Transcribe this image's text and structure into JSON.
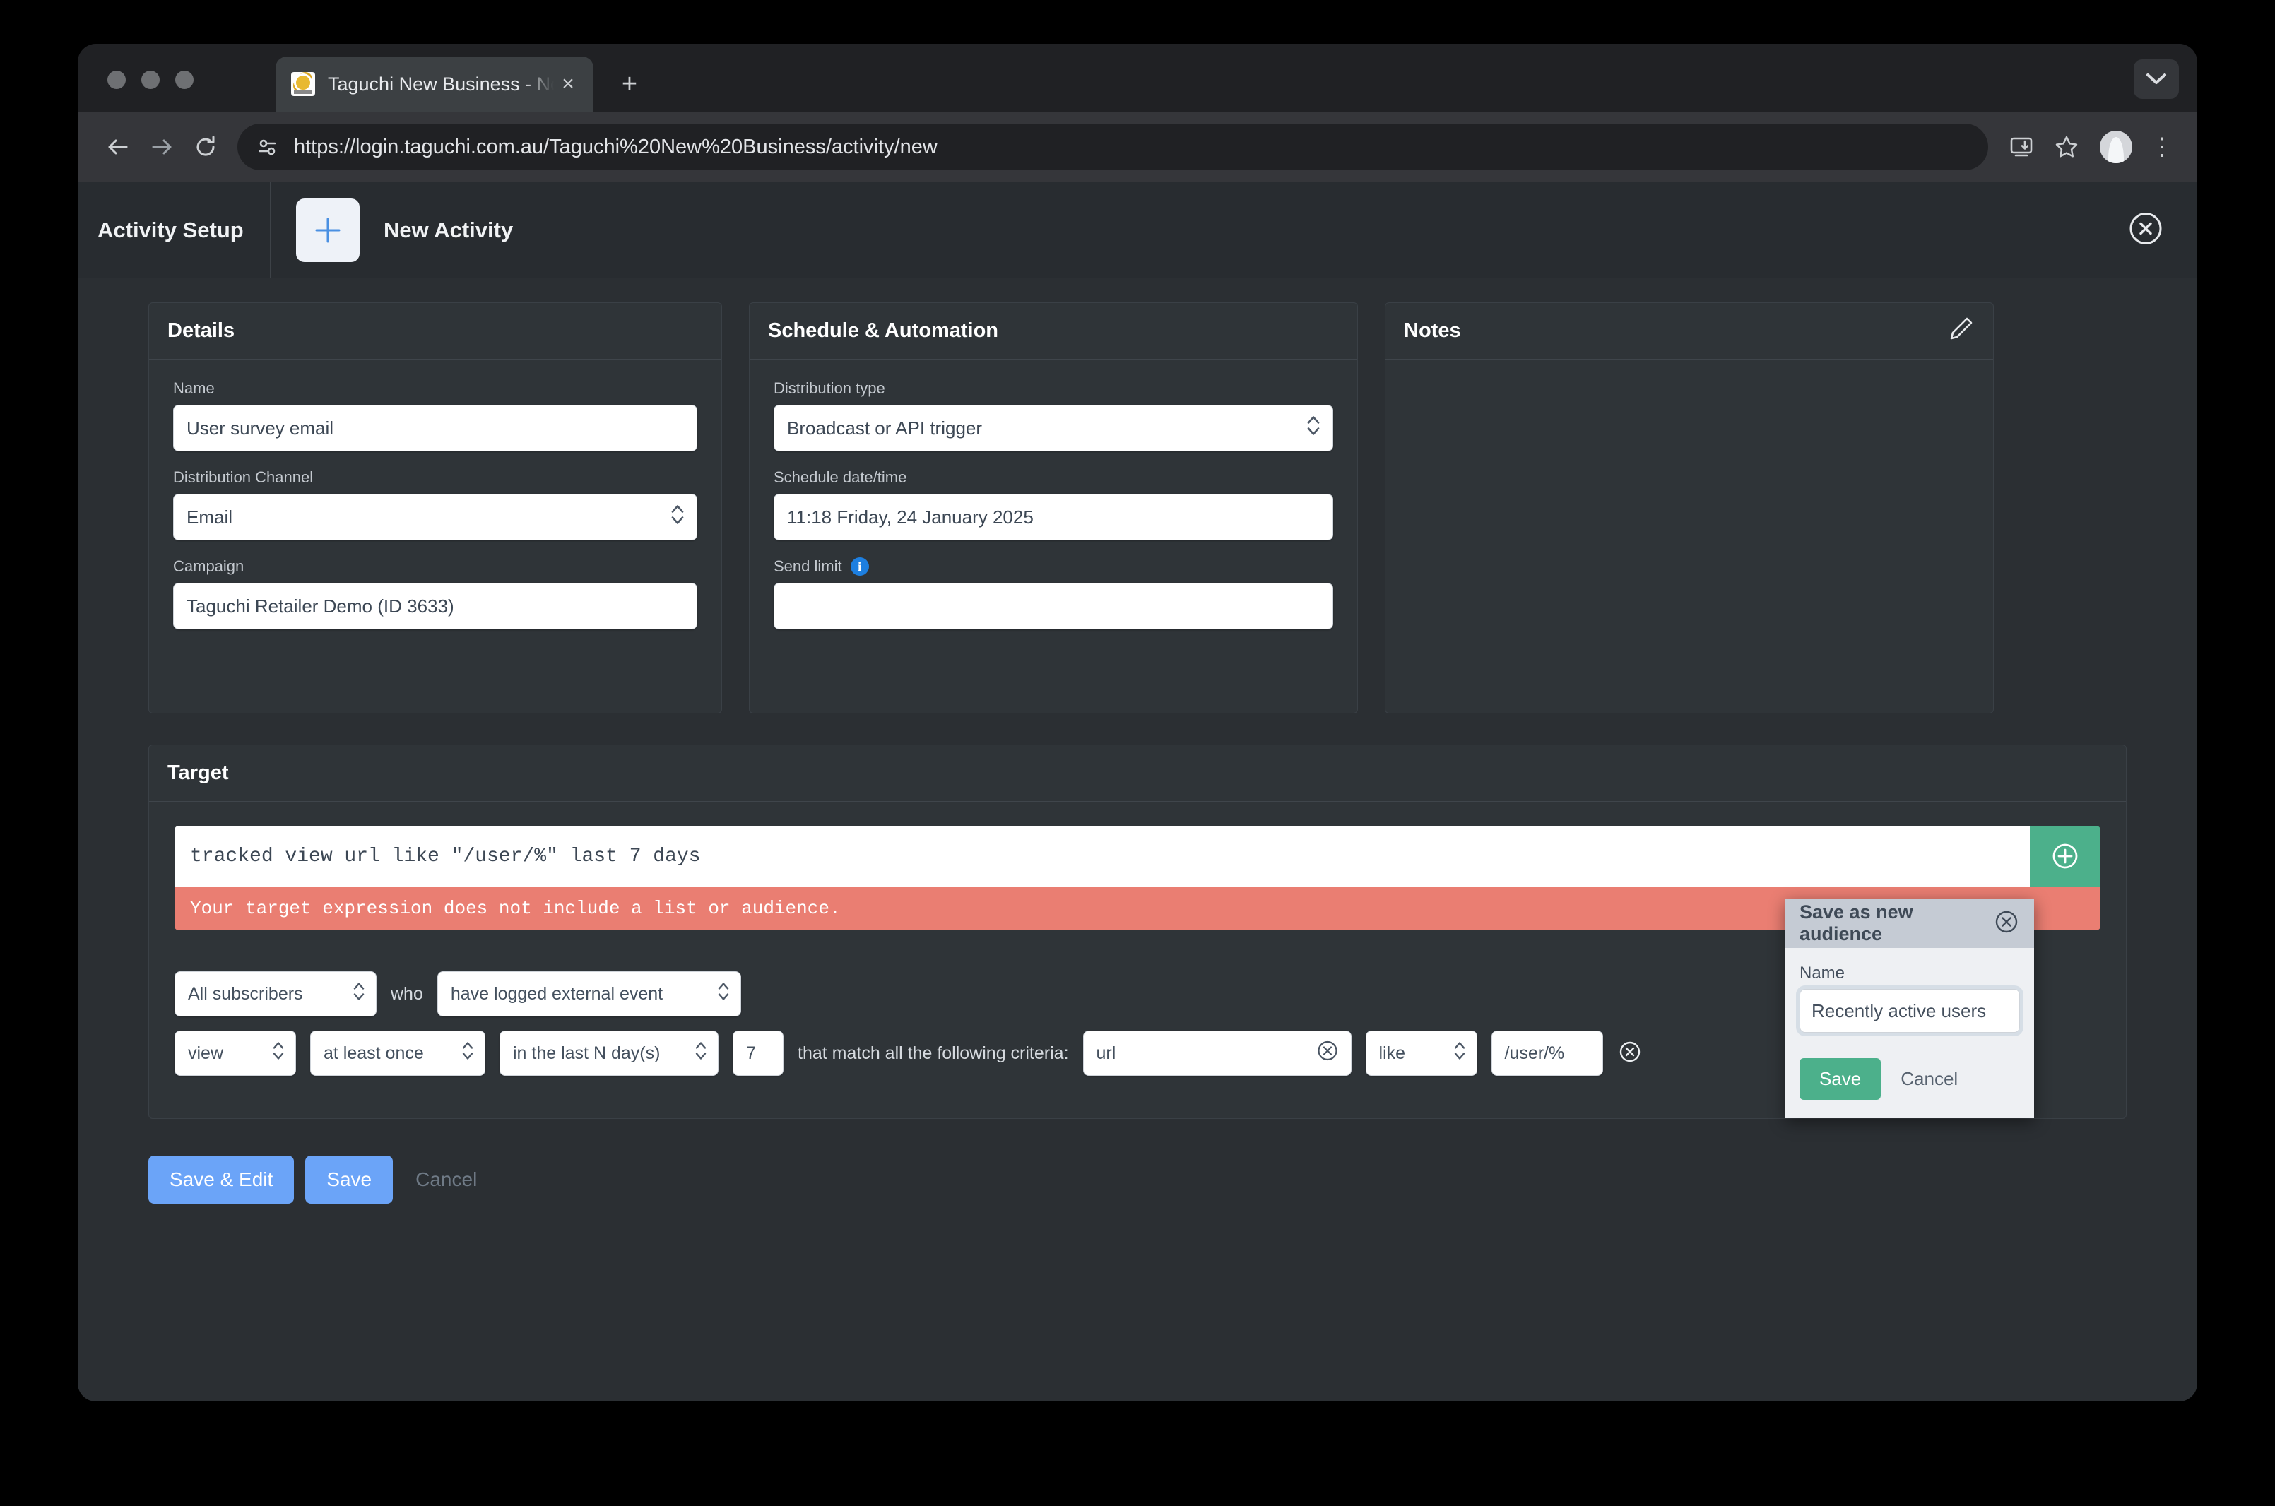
{
  "browser": {
    "tab": {
      "title": "Taguchi New Business - New",
      "favicon": "taguchi-favicon",
      "close": "×"
    },
    "new_tab_label": "+",
    "url": "https://login.taguchi.com.au/Taguchi%20New%20Business/activity/new",
    "icons": {
      "back": "back-arrow-icon",
      "forward": "forward-arrow-icon",
      "reload": "reload-icon",
      "site_info": "site-settings-icon",
      "install": "install-app-icon",
      "bookmark": "star-icon",
      "profile": "avatar-icon",
      "menu": "⋮",
      "tab_list": "chevron-down-icon"
    }
  },
  "app": {
    "header": {
      "section_title": "Activity Setup",
      "new_tile_icon": "plus-icon",
      "activity_name": "New Activity",
      "close_icon": "close-circle-icon"
    },
    "details": {
      "title": "Details",
      "fields": [
        {
          "label": "Name",
          "value": "User survey email",
          "type": "text"
        },
        {
          "label": "Distribution Channel",
          "value": "Email",
          "type": "select"
        },
        {
          "label": "Campaign",
          "value": "Taguchi Retailer Demo (ID 3633)",
          "type": "text"
        }
      ]
    },
    "schedule": {
      "title": "Schedule & Automation",
      "fields": [
        {
          "label": "Distribution type",
          "value": "Broadcast or API trigger",
          "type": "select"
        },
        {
          "label": "Schedule date/time",
          "value": "11:18 Friday, 24 January 2025",
          "type": "text"
        },
        {
          "label": "Send limit",
          "value": "",
          "type": "text",
          "info": "i"
        }
      ]
    },
    "notes": {
      "title": "Notes",
      "edit_icon": "pencil-icon",
      "body": ""
    },
    "target": {
      "title": "Target",
      "expression": "tracked view url like \"/user/%\" last 7 days",
      "add_icon": "plus-circle-icon",
      "error": "Your target expression does not include a list or audience.",
      "builder": {
        "audience": "All subscribers",
        "who_label": "who",
        "action": "have logged external event",
        "event_type": "view",
        "frequency": "at least once",
        "period": "in the last N day(s)",
        "period_value": "7",
        "criteria_label": "that match all the following criteria:",
        "criteria_field": "url",
        "criteria_operator": "like",
        "criteria_value": "/user/%",
        "clear_icon": "clear-circle-icon",
        "remove_icon": "remove-circle-icon"
      }
    },
    "popover": {
      "title": "Save as new audience",
      "close_icon": "close-circle-icon",
      "name_label": "Name",
      "name_value": "Recently active users",
      "save_label": "Save",
      "cancel_label": "Cancel"
    },
    "footer": {
      "save_edit_label": "Save & Edit",
      "save_label": "Save",
      "cancel_label": "Cancel"
    }
  },
  "colors": {
    "accent_blue": "#6ba4f8",
    "green": "#4cb08b",
    "error_red": "#ea7e72",
    "panel_bg": "#2f3438",
    "app_bg": "#2b2f33"
  }
}
